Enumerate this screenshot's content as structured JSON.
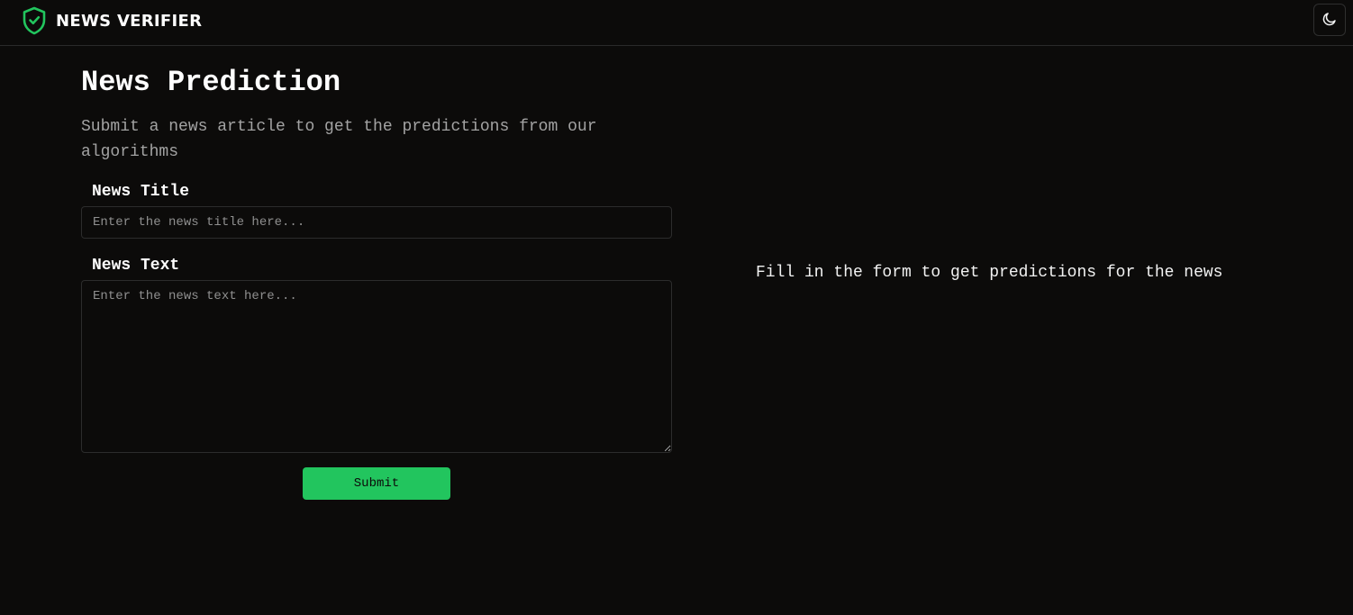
{
  "header": {
    "brand_name": "NEWS VERIFIER",
    "brand_icon": "shield-check-icon",
    "theme_toggle_icon": "moon-icon",
    "accent_color": "#22c55e"
  },
  "form": {
    "title": "News Prediction",
    "subtitle": "Submit a news article to get the predictions from our algorithms",
    "title_field": {
      "label": "News Title",
      "placeholder": "Enter the news title here...",
      "value": ""
    },
    "text_field": {
      "label": "News Text",
      "placeholder": "Enter the news text here...",
      "value": ""
    },
    "submit_label": "Submit"
  },
  "result": {
    "placeholder_text": "Fill in the form to get predictions for the news"
  }
}
